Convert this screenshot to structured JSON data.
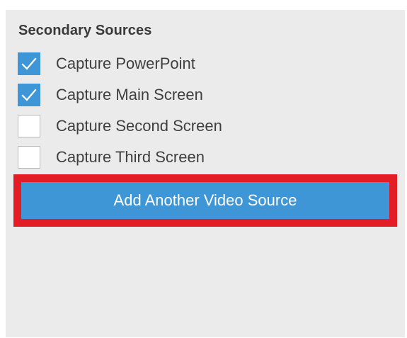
{
  "section": {
    "title": "Secondary Sources"
  },
  "options": [
    {
      "label": "Capture PowerPoint",
      "checked": true
    },
    {
      "label": "Capture Main Screen",
      "checked": true
    },
    {
      "label": "Capture Second Screen",
      "checked": false
    },
    {
      "label": "Capture Third Screen",
      "checked": false
    }
  ],
  "add_button": {
    "label": "Add Another Video Source"
  },
  "colors": {
    "accent": "#3e96d6",
    "highlight": "#e31d25",
    "panel_bg": "#ebebeb",
    "text": "#3f3f3f"
  },
  "icons": {
    "checked": "checkmark-icon"
  }
}
